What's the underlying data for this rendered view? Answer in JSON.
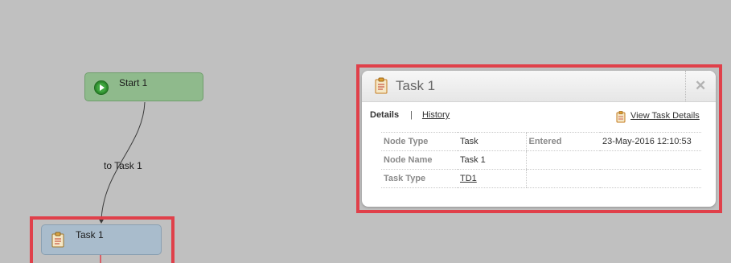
{
  "workflow": {
    "start_node": {
      "label": "Start 1"
    },
    "connector": {
      "label": "to Task 1"
    },
    "task_node": {
      "label": "Task 1"
    }
  },
  "popup": {
    "title": "Task 1",
    "close_glyph": "✕",
    "tabs": {
      "details": "Details",
      "separator": "|",
      "history": "History"
    },
    "view_link": "View Task Details",
    "rows": [
      {
        "label1": "Node Type",
        "value1": "Task",
        "label2": "Entered",
        "value2": "23-May-2016 12:10:53"
      },
      {
        "label1": "Node Name",
        "value1": "Task 1",
        "label2": "",
        "value2": ""
      },
      {
        "label1": "Task Type",
        "value1": "TD1",
        "label2": "",
        "value2": ""
      }
    ]
  },
  "colors": {
    "background": "#c0c0c0",
    "highlight": "#e0404a",
    "start_node": "#8fba8c",
    "task_node": "#a9bccc"
  },
  "icons": {
    "start": "play-icon",
    "task": "clipboard-icon",
    "close": "close-icon"
  }
}
